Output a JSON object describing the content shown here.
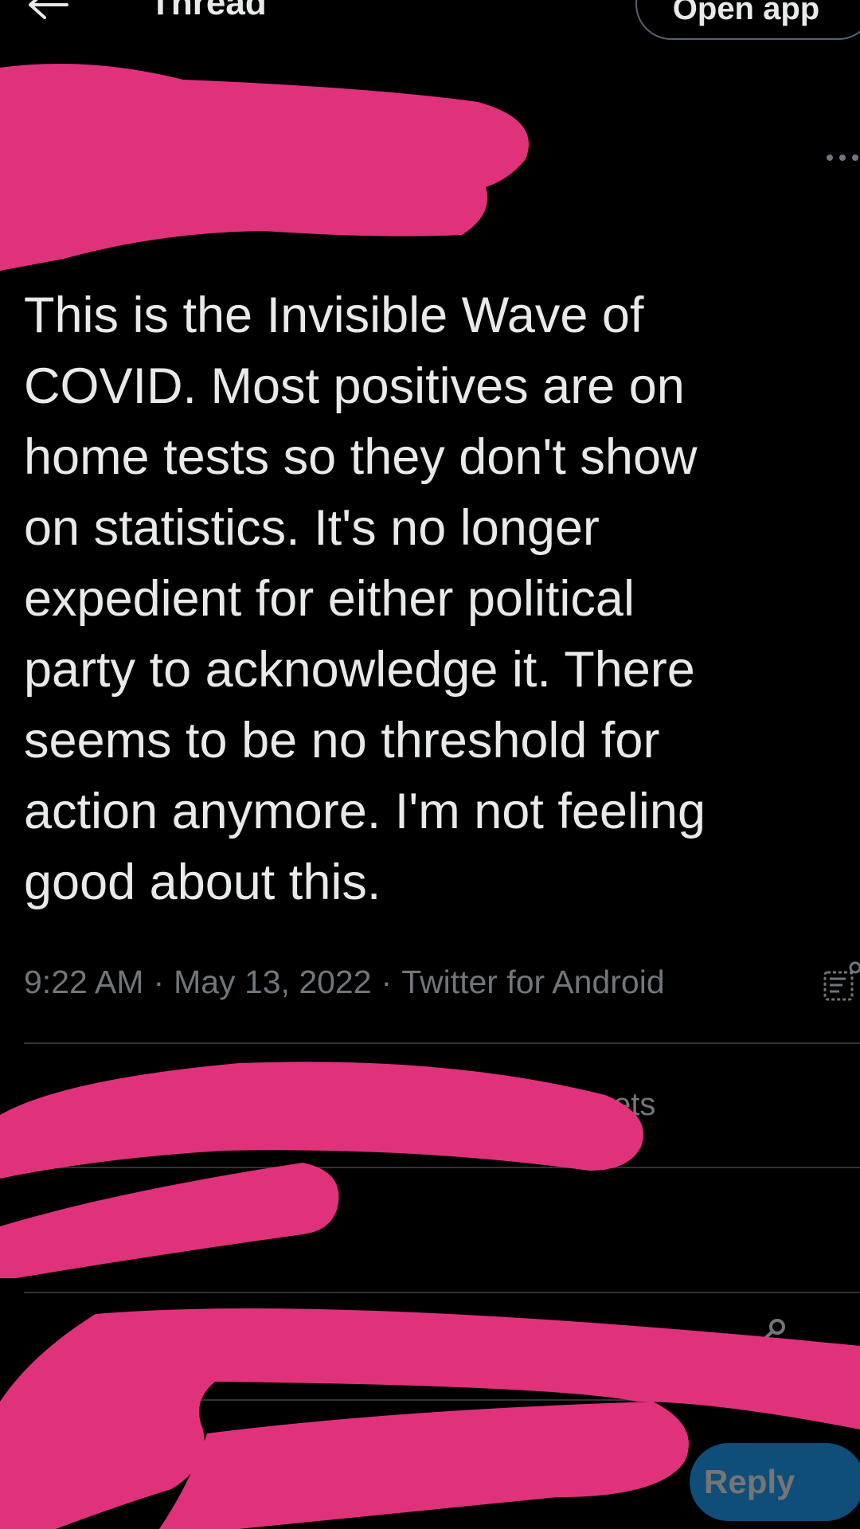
{
  "header": {
    "back_icon": "arrow-left-icon",
    "title": "Thread",
    "open_app_label": "Open app"
  },
  "tweet": {
    "more_icon": "more-horizontal-icon",
    "text": "This is the Invisible Wave of\nCOVID. Most positives are on\nhome tests so they don't show\non statistics. It's no longer\nexpedient for either political\nparty to acknowledge it. There\nseems to be no threshold for\naction anymore. I'm not feeling\ngood about this.",
    "time": "9:22 AM",
    "date": "May 13, 2022",
    "source": "Twitter for Android",
    "meta_separator": "·",
    "analytics_icon": "analytics-icon"
  },
  "stats": {
    "retweets_fragment": "ets"
  },
  "actions": {
    "share_icon": "share-icon",
    "reply_label": "Reply"
  },
  "colors": {
    "background": "#000000",
    "text": "#e7e9ea",
    "muted": "#71767b",
    "divider": "#2f3336",
    "accent": "#1d9bf0",
    "redaction": "#e0327a"
  }
}
